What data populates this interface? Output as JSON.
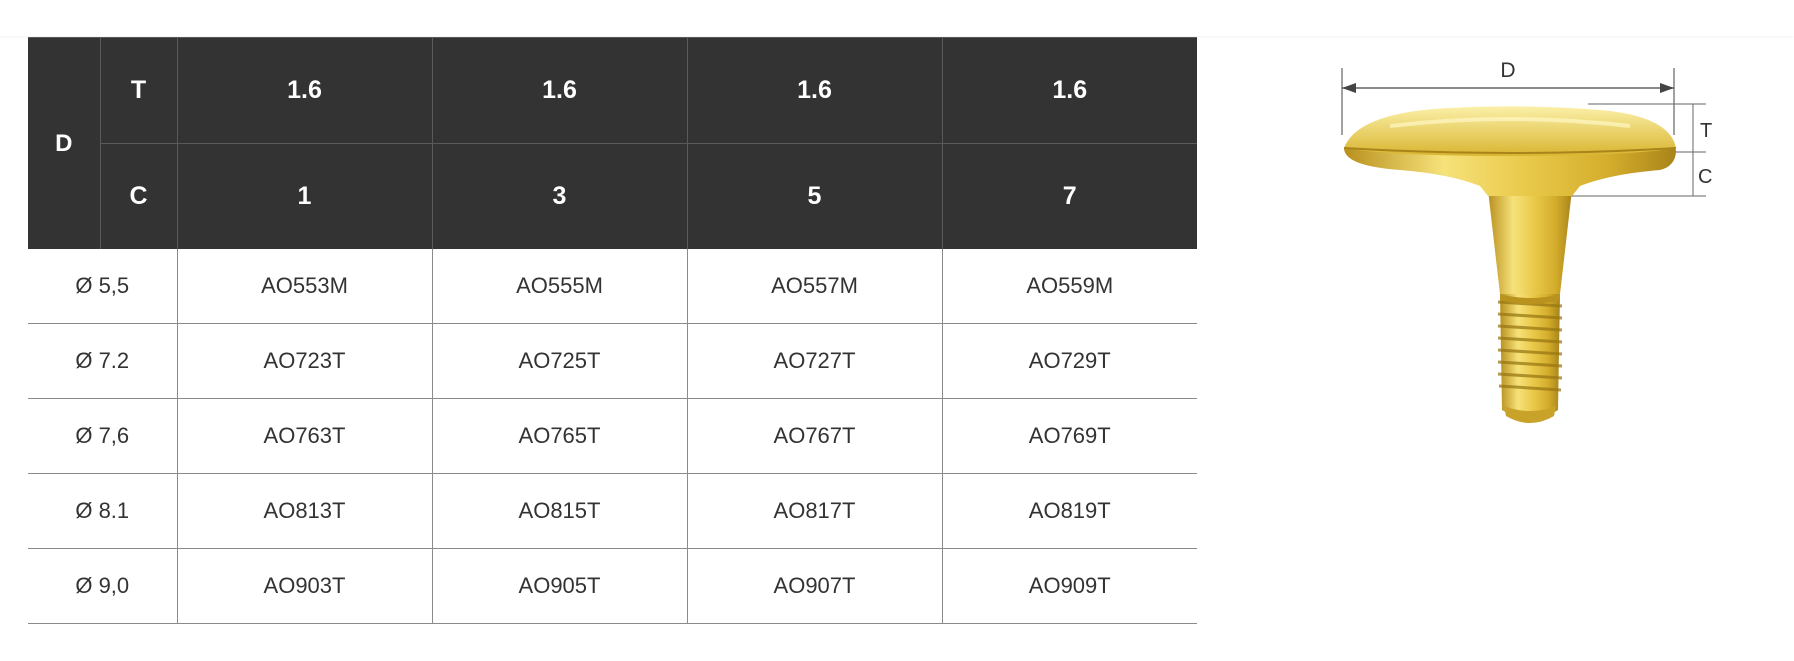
{
  "table": {
    "header": {
      "d_label": "D",
      "t_label": "T",
      "c_label": "C",
      "t_values": [
        "1.6",
        "1.6",
        "1.6",
        "1.6"
      ],
      "c_values": [
        "1",
        "3",
        "5",
        "7"
      ]
    },
    "rows": [
      {
        "diameter": "Ø 5,5",
        "codes": [
          "AO553M",
          "AO555M",
          "AO557M",
          "AO559M"
        ]
      },
      {
        "diameter": "Ø 7.2",
        "codes": [
          "AO723T",
          "AO725T",
          "AO727T",
          "AO729T"
        ]
      },
      {
        "diameter": "Ø 7,6",
        "codes": [
          "AO763T",
          "AO765T",
          "AO767T",
          "AO769T"
        ]
      },
      {
        "diameter": "Ø 8.1",
        "codes": [
          "AO813T",
          "AO815T",
          "AO817T",
          "AO819T"
        ]
      },
      {
        "diameter": "Ø 9,0",
        "codes": [
          "AO903T",
          "AO905T",
          "AO907T",
          "AO909T"
        ]
      }
    ]
  },
  "figure": {
    "d_label": "D",
    "t_label": "T",
    "c_label": "C",
    "colors": {
      "gold_light": "#f6e27a",
      "gold": "#d9b530",
      "gold_dark": "#a8841a"
    }
  }
}
